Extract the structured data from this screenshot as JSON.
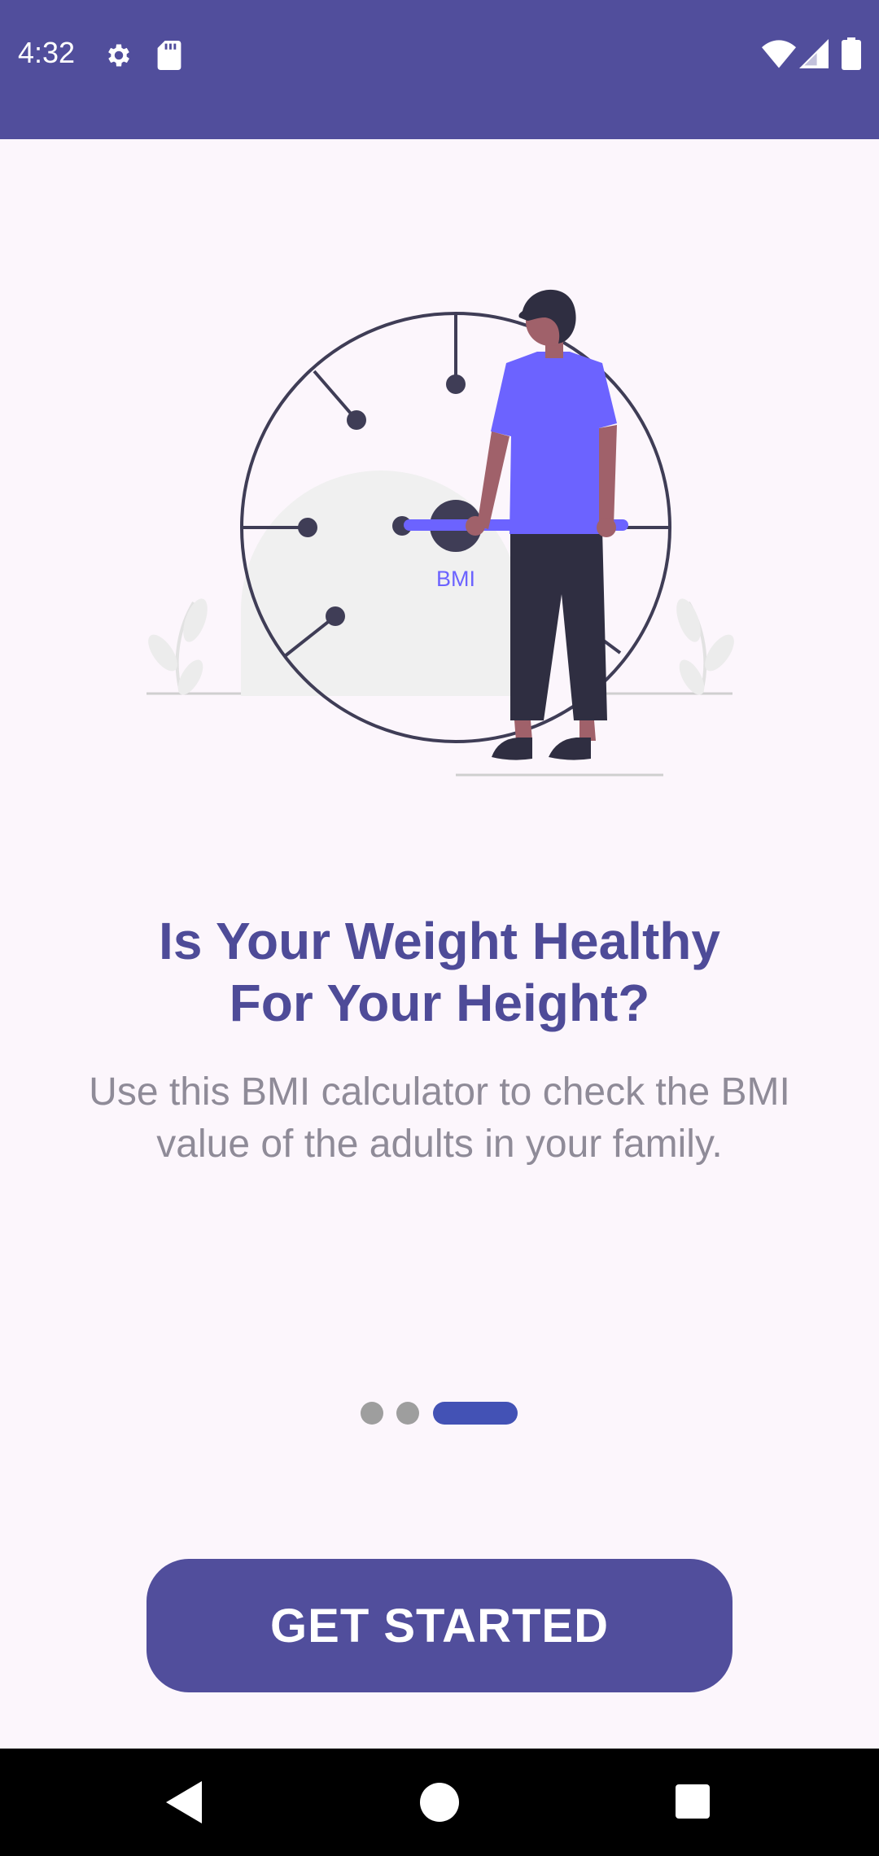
{
  "status_bar": {
    "time": "4:32",
    "icons_left": [
      "gear-icon",
      "sd-card-icon"
    ],
    "icons_right": [
      "wifi-icon",
      "cellular-signal-icon",
      "battery-icon"
    ]
  },
  "illustration": {
    "gauge_label": "BMI",
    "accent_color": "#6c63ff"
  },
  "onboarding": {
    "title_line1": "Is Your Weight Healthy",
    "title_line2": "For Your Height?",
    "description_line1": "Use this BMI calculator to check the BMI",
    "description_line2": "value of the adults in your family.",
    "page_indicator": {
      "total": 3,
      "current": 3
    }
  },
  "cta": {
    "label": "GET STARTED"
  },
  "navigation_bar": {
    "buttons": [
      "back-icon",
      "home-icon",
      "recents-icon"
    ]
  },
  "colors": {
    "primary": "#514e9c",
    "title": "#4e4b98",
    "body_text": "#8f8b98",
    "indicator_active": "#4352b5",
    "indicator_inactive": "#9e9e9e",
    "background": "#fcf6fc"
  }
}
